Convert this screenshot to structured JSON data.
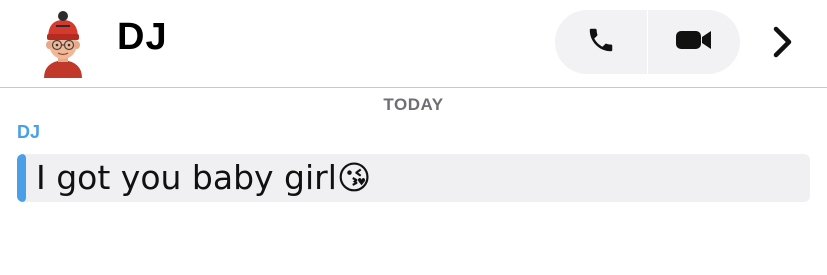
{
  "header": {
    "contact_name": "DJ",
    "avatar_icon": "bitmoji-avatar-icon",
    "phone_icon": "phone-icon",
    "video_icon": "video-camera-icon",
    "details_icon": "chevron-right-icon"
  },
  "conversation": {
    "date_label": "TODAY",
    "messages": [
      {
        "sender": "DJ",
        "text": "I got you baby girl😘",
        "accent_color": "#4a9fe8"
      }
    ]
  },
  "colors": {
    "accent": "#4a9fe8",
    "call_pill_bg": "#f2f2f5",
    "message_bg": "#f0f0f2"
  }
}
